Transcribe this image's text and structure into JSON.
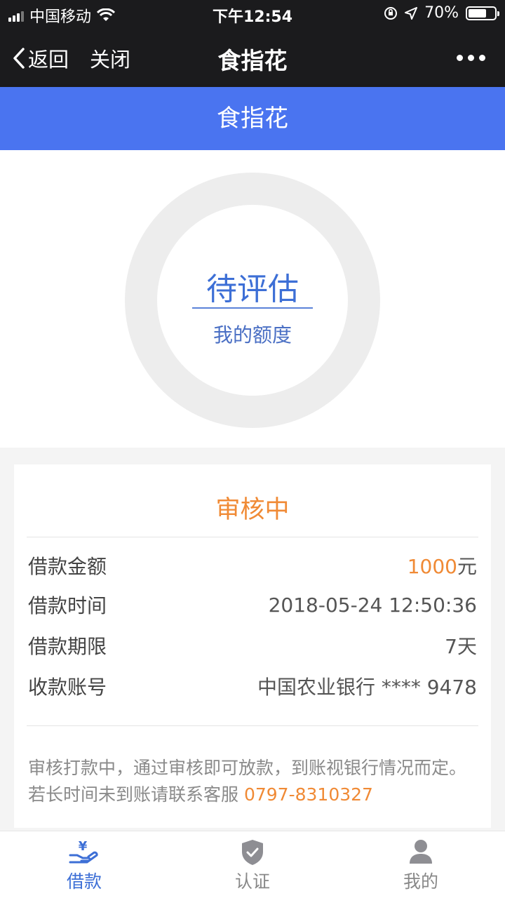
{
  "status_bar": {
    "carrier": "中国移动",
    "time": "下午12:54",
    "battery": "70%",
    "battery_level": 0.7
  },
  "nav": {
    "back_label": "返回",
    "close_label": "关闭",
    "title": "食指花"
  },
  "header": {
    "title": "食指花"
  },
  "quota": {
    "status": "待评估",
    "label": "我的额度"
  },
  "loan": {
    "status": "审核中",
    "rows": [
      {
        "label": "借款金额",
        "value": "1000",
        "unit": "元"
      },
      {
        "label": "借款时间",
        "value": "2018-05-24 12:50:36"
      },
      {
        "label": "借款期限",
        "value": "7天"
      },
      {
        "label": "收款账号",
        "value": "中国农业银行 **** 9478"
      }
    ],
    "note": "审核打款中，通过审核即可放款，到账视银行情况而定。若长时间未到账请联系客服",
    "phone": "0797-8310327"
  },
  "tabs": [
    {
      "label": "借款",
      "icon": "hand-yen-icon"
    },
    {
      "label": "认证",
      "icon": "shield-check-icon"
    },
    {
      "label": "我的",
      "icon": "person-icon"
    }
  ],
  "colors": {
    "header_blue": "#4a74f0",
    "accent_orange": "#f08a35",
    "active_tab": "#3d6fd6"
  }
}
